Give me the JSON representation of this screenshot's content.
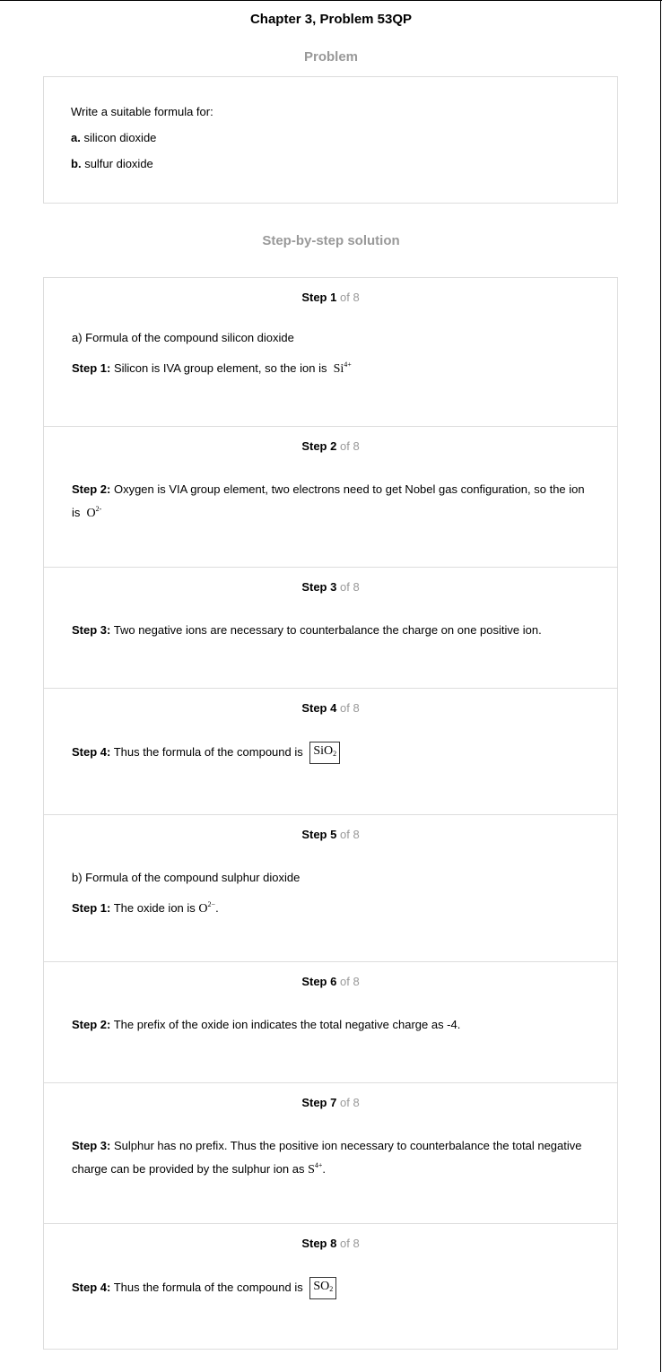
{
  "title": "Chapter 3, Problem 53QP",
  "problem_heading": "Problem",
  "problem": {
    "intro": "Write a suitable formula for:",
    "items": [
      {
        "label": "a.",
        "text": "silicon dioxide"
      },
      {
        "label": "b.",
        "text": "sulfur dioxide"
      }
    ]
  },
  "solution_heading": "Step-by-step solution",
  "step_word": "Step",
  "of_total": "of 8",
  "steps": [
    {
      "num": "1",
      "pre": "a) Formula of the compound silicon dioxide",
      "label": "Step 1:",
      "text": "Silicon is IVA group element, so the ion is",
      "math": "Si",
      "sup": "4+",
      "after": ""
    },
    {
      "num": "2",
      "label": "Step 2:",
      "text": "Oxygen is VIA group element, two electrons need to get Nobel gas configuration, so the ion is",
      "math": "O",
      "sup": "2-",
      "after": ""
    },
    {
      "num": "3",
      "label": "Step 3:",
      "text": "Two negative ions are necessary to counterbalance the charge on one positive ion."
    },
    {
      "num": "4",
      "label": "Step 4:",
      "text": "Thus the formula of the compound is",
      "math": "SiO",
      "sub": "2"
    },
    {
      "num": "5",
      "pre": "b) Formula of the compound sulphur dioxide",
      "label": "Step 1:",
      "text": "The oxide ion is",
      "math": "O",
      "sup": "2−",
      "after": "."
    },
    {
      "num": "6",
      "label": "Step 2:",
      "text": "The prefix of the oxide ion indicates the total negative charge as -4."
    },
    {
      "num": "7",
      "label": "Step 3:",
      "text": "Sulphur has no prefix. Thus the positive ion necessary to counterbalance the total negative charge can be provided by the sulphur ion as",
      "math": "S",
      "sup": "4+",
      "after": "."
    },
    {
      "num": "8",
      "label": "Step 4:",
      "text": "Thus the formula of the compound is",
      "math": "SO",
      "sub": "2"
    }
  ]
}
